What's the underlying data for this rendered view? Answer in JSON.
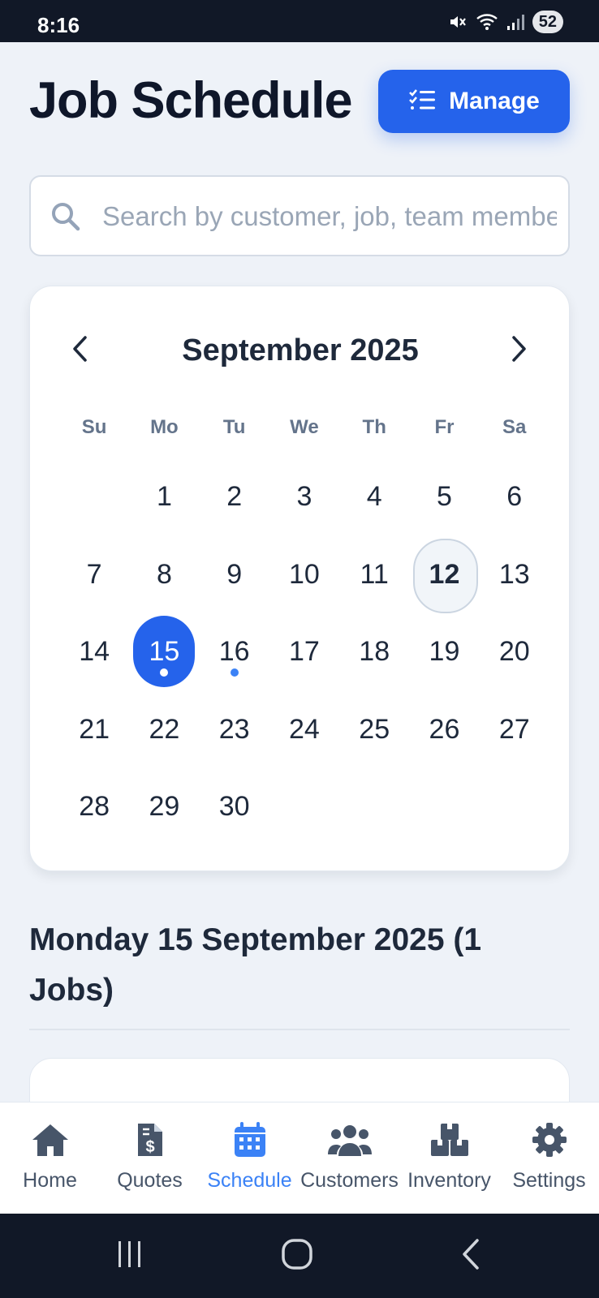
{
  "status_bar": {
    "time": "8:16",
    "battery": "52"
  },
  "header": {
    "title": "Job Schedule",
    "manage_label": "Manage"
  },
  "search": {
    "placeholder": "Search by customer, job, team member..."
  },
  "calendar": {
    "month_label": "September 2025",
    "weekdays": [
      "Su",
      "Mo",
      "Tu",
      "We",
      "Th",
      "Fr",
      "Sa"
    ],
    "leading_blanks": 1,
    "days": [
      "1",
      "2",
      "3",
      "4",
      "5",
      "6",
      "7",
      "8",
      "9",
      "10",
      "11",
      "12",
      "13",
      "14",
      "15",
      "16",
      "17",
      "18",
      "19",
      "20",
      "21",
      "22",
      "23",
      "24",
      "25",
      "26",
      "27",
      "28",
      "29",
      "30"
    ],
    "today": "12",
    "selected": "15",
    "days_with_jobs": [
      "15",
      "16"
    ]
  },
  "schedule": {
    "heading": "Monday 15 September 2025 (1 Jobs)"
  },
  "bottom_nav": {
    "items": [
      {
        "label": "Home",
        "icon": "home-icon"
      },
      {
        "label": "Quotes",
        "icon": "invoice-dollar-icon"
      },
      {
        "label": "Schedule",
        "icon": "calendar-icon",
        "active": true
      },
      {
        "label": "Customers",
        "icon": "users-icon"
      },
      {
        "label": "Inventory",
        "icon": "boxes-icon"
      },
      {
        "label": "Settings",
        "icon": "gear-icon"
      }
    ]
  },
  "colors": {
    "accent": "#2563eb",
    "active_nav": "#3b82f6",
    "background": "#eef2f8"
  }
}
